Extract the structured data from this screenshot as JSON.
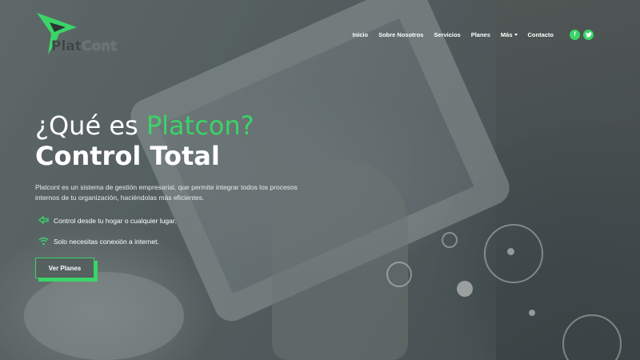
{
  "brand": {
    "logo_text_part1": "Plat",
    "logo_text_part2": "Cont",
    "accent_color": "#3ad468"
  },
  "nav": {
    "items": [
      {
        "label": "Inicio"
      },
      {
        "label": "Sobre Nosotros"
      },
      {
        "label": "Servicios"
      },
      {
        "label": "Planes"
      },
      {
        "label": "Más"
      },
      {
        "label": "Contacto"
      }
    ],
    "social": [
      {
        "icon": "facebook-icon",
        "glyph": "f"
      },
      {
        "icon": "twitter-icon",
        "glyph": "t"
      }
    ]
  },
  "hero": {
    "title_prefix": "¿Qué es ",
    "title_accent": "Platcon?",
    "title_line2": "Control Total",
    "description": "Platcont es un sistema de gestión empresarial, que permite integrar todos los procesos internos de tu organización, haciéndolas más eficientes.",
    "features": [
      {
        "icon": "remote-control-icon",
        "text": "Control desde tu hogar o cualquier lugar."
      },
      {
        "icon": "wifi-icon",
        "text": "Solo necesitas conexión a internet."
      }
    ],
    "cta_label": "Ver Planes"
  }
}
